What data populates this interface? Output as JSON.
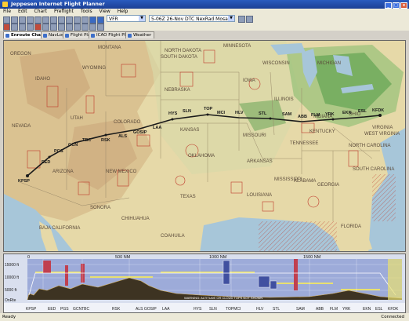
{
  "window": {
    "title": "Jeppesen Internet Flight Planner"
  },
  "menu": [
    "File",
    "Edit",
    "Chart",
    "Preflight",
    "Tools",
    "View",
    "Help"
  ],
  "toolbar": {
    "flight_rules": "VFR",
    "overlay_select": "5-06Z 26-Nov DTC NexRad Mosaic"
  },
  "tabs": [
    {
      "label": "Enroute Chart",
      "active": true
    },
    {
      "label": "NavLog",
      "active": false
    },
    {
      "label": "Flight Plan",
      "active": false
    },
    {
      "label": "ICAO Flight Plan",
      "active": false
    },
    {
      "label": "Weather",
      "active": false
    }
  ],
  "map": {
    "regions": [
      "NORTH DAKOTA",
      "SOUTH DAKOTA",
      "WYOMING",
      "NEBRASKA",
      "IOWA",
      "ILLINOIS",
      "ARIZONA",
      "BAJA CALIFORNIA",
      "NEW MEXICO",
      "SONORA",
      "CHIHUAHUA",
      "TENNESSEE",
      "KENTUCKY",
      "MISSOURI",
      "KANSAS",
      "OKLAHOMA",
      "TEXAS",
      "ARKANSAS",
      "LOUISIANA",
      "MISSISSIPPI",
      "ALABAMA",
      "GEORGIA",
      "WISCONSIN",
      "MICHIGAN",
      "INDIANA",
      "OHIO",
      "NEVADA",
      "UTAH",
      "COLORADO",
      "COAHUILA",
      "NORTH CAROLINA",
      "SOUTH CAROLINA",
      "FLORIDA",
      "OREGON",
      "IDAHO",
      "MONTANA",
      "MINNESOTA",
      "WEST VIRGINIA",
      "VIRGINIA"
    ],
    "waypoints": [
      "KPSP",
      "EED",
      "PGS",
      "GCN",
      "TBC",
      "RSK",
      "ALS",
      "GOSIP",
      "LAA",
      "HYS",
      "SLN",
      "TOP",
      "MCI",
      "HLV",
      "STL",
      "SAM",
      "ABB",
      "FLM",
      "YRK",
      "EKN",
      "ESL",
      "KFDK"
    ],
    "colors": {
      "land": "#e6d9a8",
      "water": "#a7c6d9",
      "route": "#1a1a1a",
      "airspace": "#c0392b",
      "weather": "#4f9a45"
    }
  },
  "profile": {
    "distance_ticks": [
      "0",
      "500 NM",
      "1000 NM",
      "1500 NM"
    ],
    "altitude_ticks": [
      "15000 ft",
      "10000 ft",
      "5000 ft",
      "OnRte"
    ],
    "waypoints": [
      "KPSP",
      "EED",
      "PGS",
      "GCNTBC",
      "RSK",
      "ALS GOSIP",
      "LAA",
      "HYS",
      "SLN",
      "TOPMCI",
      "HLV",
      "STL",
      "SAM",
      "ABB",
      "FLM",
      "YRK",
      "EKN",
      "ESL",
      "KFDK"
    ],
    "warning": "WARNING: ALTITUDE OR CLOUD TOPS NOT SHOWN"
  },
  "status": {
    "left": "Ready",
    "right": "Connected"
  }
}
